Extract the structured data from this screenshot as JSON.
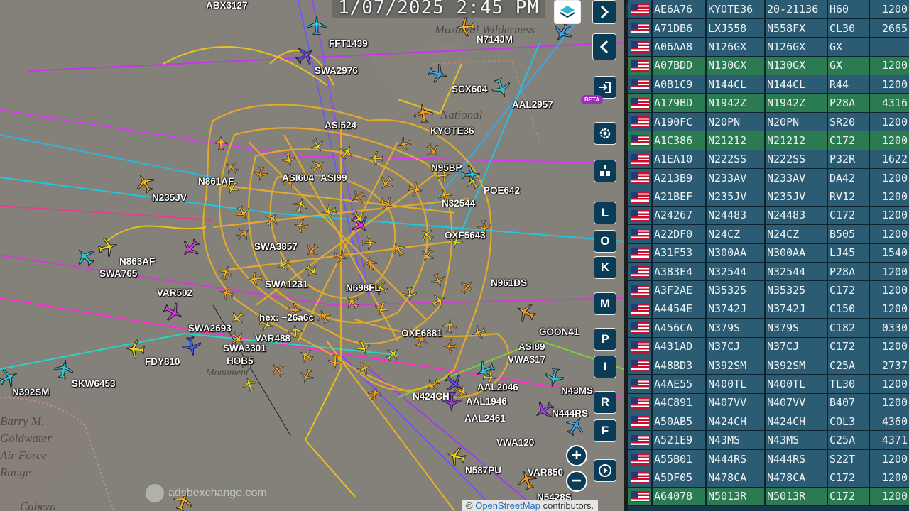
{
  "clock": "1/07/2025 2:45 PM",
  "map": {
    "labels": [
      "ABX3127",
      "FFT1439",
      "N714JM",
      "SWA2976",
      "SCX604",
      "AAL2957",
      "ASI524",
      "KYOTE36",
      "N861AF",
      "ASI604",
      "ASI99",
      "N95BP",
      "POE642",
      "N235JV",
      "N32544",
      "OXF5643",
      "N863AF",
      "SWA765",
      "VAR502",
      "SWA3857",
      "SWA1231",
      "N698FL",
      "N961DS",
      "hex: ~26a6c",
      "SWA2693",
      "VAR488",
      "OXF6881",
      "GOON41",
      "FDY810",
      "SWA3301",
      "HOB5",
      "SKW6453",
      "N392SM",
      "AAL2046",
      "N43MS",
      "AAL1946",
      "AAL2461",
      "N444RS",
      "VWA120",
      "N587PU",
      "VAR850",
      "N5428S",
      "VWA317",
      "ASI89",
      "N424CH"
    ],
    "place_names": [
      "Mazatzal Wilderness",
      "National",
      "Barry M. Goldwater Air Force Range",
      "Cabeza",
      "Monument"
    ],
    "watermark": "adsbexchange.com",
    "attribution_prefix": "©",
    "attribution_link": "OpenStreetMap",
    "attribution_suffix": "contributors."
  },
  "controls": {
    "letters": [
      "L",
      "O",
      "K",
      "M",
      "P",
      "I",
      "R",
      "F"
    ],
    "beta_label": "BETA",
    "zoom_in": "+",
    "zoom_out": "−",
    "icons": [
      "layers-icon",
      "next-icon",
      "collapse-icon",
      "login-icon",
      "settings-icon",
      "filter-icon",
      "replay-icon"
    ]
  },
  "table": {
    "rows": [
      {
        "hex": "AE6A76",
        "callsign": "KYOTE36",
        "reg": "20-21136",
        "type": "H60",
        "squawk": "1200",
        "hl": false
      },
      {
        "hex": "A71DB6",
        "callsign": "LXJ558",
        "reg": "N558FX",
        "type": "CL30",
        "squawk": "2665",
        "hl": false
      },
      {
        "hex": "A06AA8",
        "callsign": "N126GX",
        "reg": "N126GX",
        "type": "GX",
        "squawk": "",
        "hl": false
      },
      {
        "hex": "A07BDD",
        "callsign": "N130GX",
        "reg": "N130GX",
        "type": "GX",
        "squawk": "1200",
        "hl": true
      },
      {
        "hex": "A0B1C9",
        "callsign": "N144CL",
        "reg": "N144CL",
        "type": "R44",
        "squawk": "1200",
        "hl": false
      },
      {
        "hex": "A179BD",
        "callsign": "N1942Z",
        "reg": "N1942Z",
        "type": "P28A",
        "squawk": "4316",
        "hl": true
      },
      {
        "hex": "A190FC",
        "callsign": "N20PN",
        "reg": "N20PN",
        "type": "SR20",
        "squawk": "1200",
        "hl": false
      },
      {
        "hex": "A1C386",
        "callsign": "N21212",
        "reg": "N21212",
        "type": "C172",
        "squawk": "1200",
        "hl": true
      },
      {
        "hex": "A1EA10",
        "callsign": "N222SS",
        "reg": "N222SS",
        "type": "P32R",
        "squawk": "1622",
        "hl": false
      },
      {
        "hex": "A213B9",
        "callsign": "N233AV",
        "reg": "N233AV",
        "type": "DA42",
        "squawk": "1200",
        "hl": false
      },
      {
        "hex": "A21BEF",
        "callsign": "N235JV",
        "reg": "N235JV",
        "type": "RV12",
        "squawk": "1200",
        "hl": false
      },
      {
        "hex": "A24267",
        "callsign": "N24483",
        "reg": "N24483",
        "type": "C172",
        "squawk": "1200",
        "hl": false
      },
      {
        "hex": "A22DF0",
        "callsign": "N24CZ",
        "reg": "N24CZ",
        "type": "B505",
        "squawk": "1200",
        "hl": false
      },
      {
        "hex": "A31F53",
        "callsign": "N300AA",
        "reg": "N300AA",
        "type": "LJ45",
        "squawk": "1540",
        "hl": false
      },
      {
        "hex": "A383E4",
        "callsign": "N32544",
        "reg": "N32544",
        "type": "P28A",
        "squawk": "1200",
        "hl": false
      },
      {
        "hex": "A3F2AE",
        "callsign": "N35325",
        "reg": "N35325",
        "type": "C172",
        "squawk": "1200",
        "hl": false
      },
      {
        "hex": "A4454E",
        "callsign": "N3742J",
        "reg": "N3742J",
        "type": "C150",
        "squawk": "1200",
        "hl": false
      },
      {
        "hex": "A456CA",
        "callsign": "N379S",
        "reg": "N379S",
        "type": "C182",
        "squawk": "0330",
        "hl": false
      },
      {
        "hex": "A431AD",
        "callsign": "N37CJ",
        "reg": "N37CJ",
        "type": "C172",
        "squawk": "1200",
        "hl": false
      },
      {
        "hex": "A48BD3",
        "callsign": "N392SM",
        "reg": "N392SM",
        "type": "C25A",
        "squawk": "2737",
        "hl": false
      },
      {
        "hex": "A4AE55",
        "callsign": "N400TL",
        "reg": "N400TL",
        "type": "TL30",
        "squawk": "1200",
        "hl": false
      },
      {
        "hex": "A4C891",
        "callsign": "N407VV",
        "reg": "N407VV",
        "type": "B407",
        "squawk": "1200",
        "hl": false
      },
      {
        "hex": "A50AB5",
        "callsign": "N424CH",
        "reg": "N424CH",
        "type": "COL3",
        "squawk": "4360",
        "hl": false
      },
      {
        "hex": "A521E9",
        "callsign": "N43MS",
        "reg": "N43MS",
        "type": "C25A",
        "squawk": "4371",
        "hl": false
      },
      {
        "hex": "A55B01",
        "callsign": "N444RS",
        "reg": "N444RS",
        "type": "S22T",
        "squawk": "1200",
        "hl": false
      },
      {
        "hex": "A5DF05",
        "callsign": "N478CA",
        "reg": "N478CA",
        "type": "C172",
        "squawk": "1200",
        "hl": false
      },
      {
        "hex": "A64078",
        "callsign": "N5013R",
        "reg": "N5013R",
        "type": "C172",
        "squawk": "1200",
        "hl": true
      }
    ]
  }
}
